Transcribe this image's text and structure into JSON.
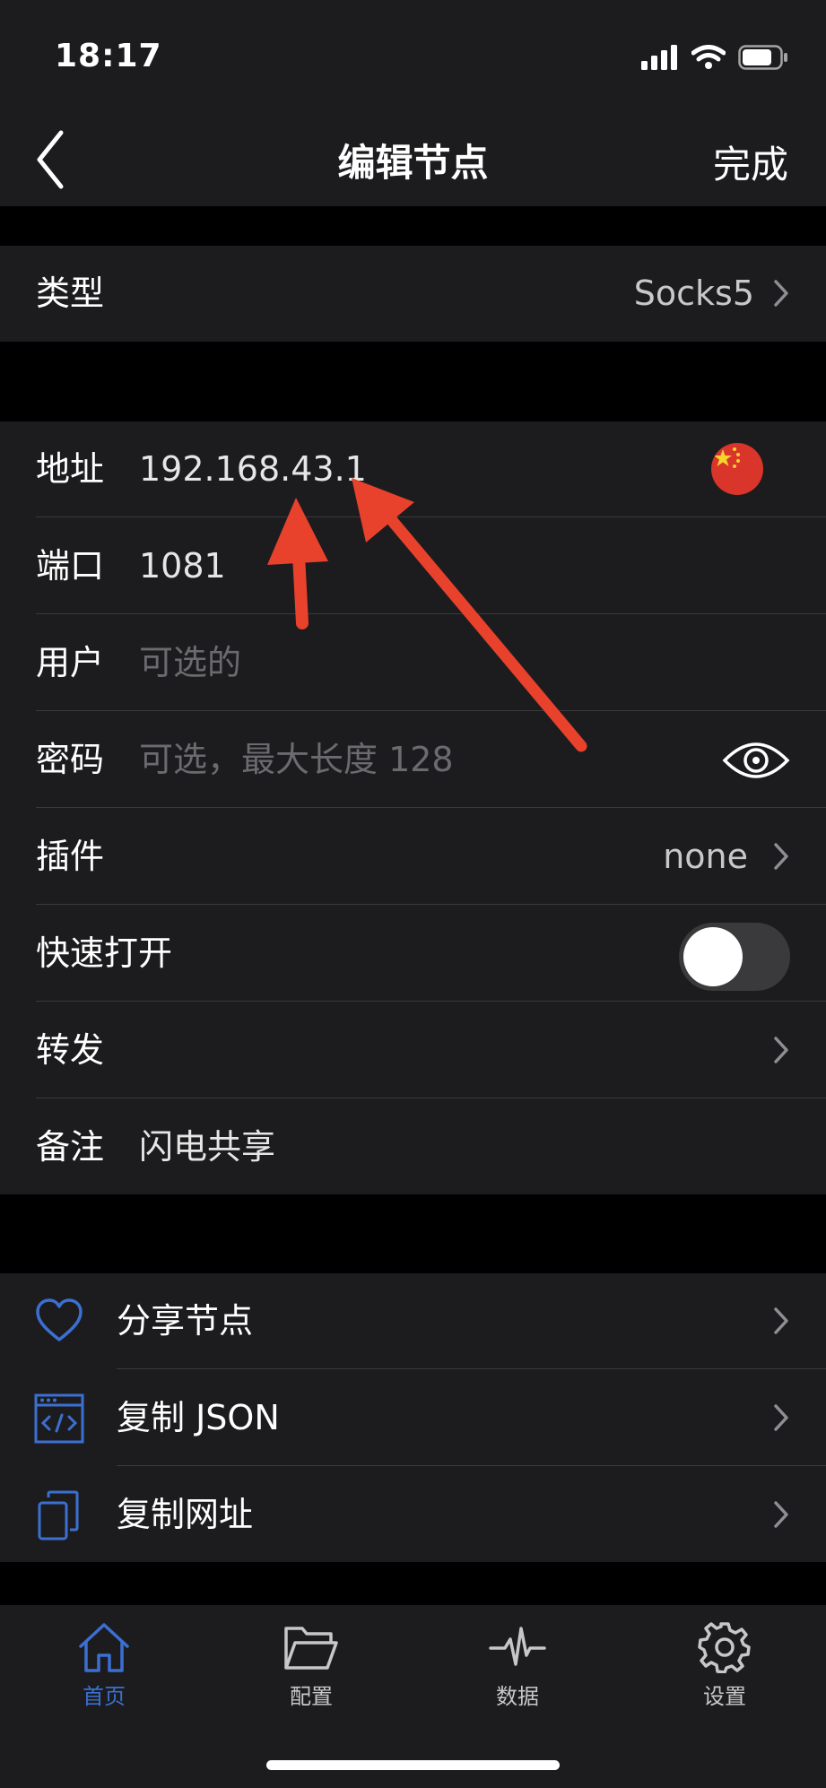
{
  "status": {
    "time": "18:17"
  },
  "nav": {
    "title": "编辑节点",
    "done": "完成"
  },
  "type_row": {
    "label": "类型",
    "value": "Socks5"
  },
  "form": {
    "address": {
      "label": "地址",
      "value": "192.168.43.1"
    },
    "port": {
      "label": "端口",
      "value": "1081"
    },
    "user": {
      "label": "用户",
      "placeholder": "可选的"
    },
    "password": {
      "label": "密码",
      "placeholder": "可选，最大长度 128"
    },
    "plugin": {
      "label": "插件",
      "value": "none"
    },
    "quick_open": {
      "label": "快速打开",
      "on": false
    },
    "forward": {
      "label": "转发"
    },
    "note": {
      "label": "备注",
      "value": "闪电共享"
    }
  },
  "share": {
    "share_node": "分享节点",
    "copy_json": "复制 JSON",
    "copy_url": "复制网址"
  },
  "tabs": [
    {
      "label": "首页",
      "icon": "home-icon",
      "active": true
    },
    {
      "label": "配置",
      "icon": "folder-icon",
      "active": false
    },
    {
      "label": "数据",
      "icon": "pulse-icon",
      "active": false
    },
    {
      "label": "设置",
      "icon": "gear-icon",
      "active": false
    }
  ],
  "colors": {
    "accent": "#3b6fd1",
    "annotation_arrow": "#e8412c",
    "background": "#1c1c1e"
  }
}
